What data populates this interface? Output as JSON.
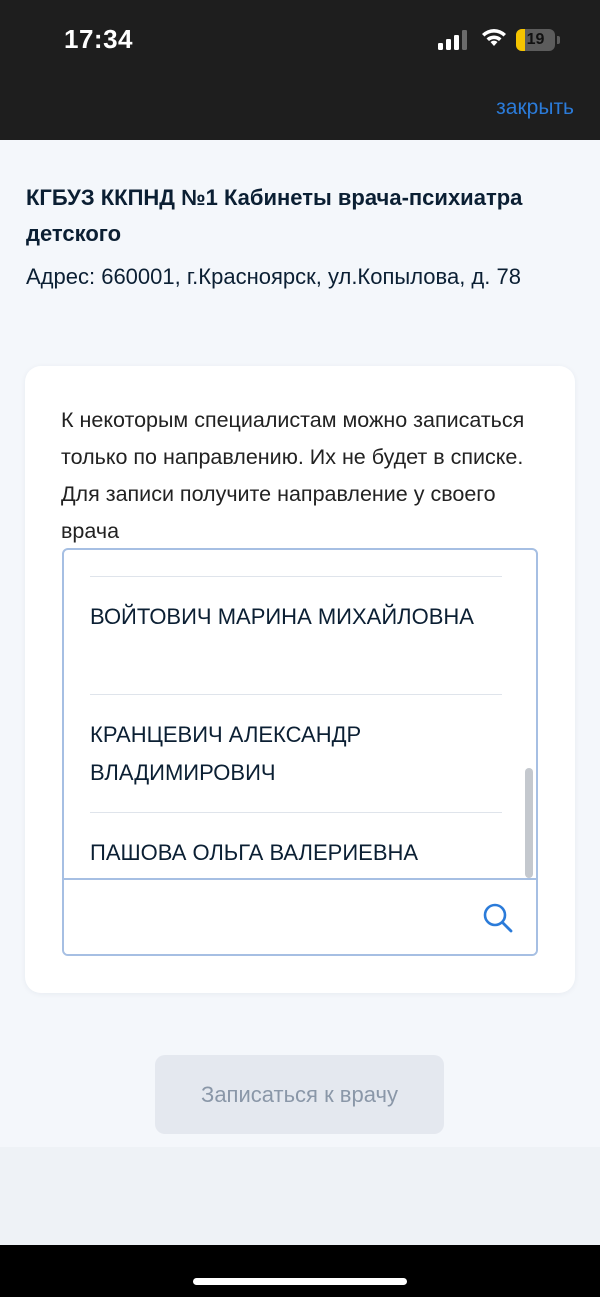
{
  "status_bar": {
    "time": "17:34",
    "battery_level": "19",
    "battery_percent": 19,
    "icons": [
      "signal-icon",
      "wifi-icon",
      "battery-icon"
    ]
  },
  "header": {
    "close_label": "закрыть"
  },
  "clinic": {
    "name": "КГБУЗ ККПНД №1 Кабинеты врача-психиатра детского",
    "address": "Адрес: 660001, г.Красноярск, ул.Копылова, д. 78"
  },
  "notice": "К некоторым специалистам можно записаться только по направлению. Их не будет в списке. Для записи получите направление у своего врача",
  "doctors": {
    "items": [
      "ВОЙТОВИЧ МАРИНА МИХАЙЛОВНА",
      "КРАНЦЕВИЧ АЛЕКСАНДР ВЛАДИМИРОВИЧ",
      "ПАШОВА ОЛЬГА ВАЛЕРИЕВНА"
    ],
    "search_value": ""
  },
  "submit_label": "Записаться к врачу",
  "colors": {
    "accent": "#2b7bd9",
    "border": "#a6bfe3",
    "button_disabled_bg": "#e4e8ef",
    "button_disabled_text": "#8a97a8",
    "battery": "#f5c400"
  }
}
